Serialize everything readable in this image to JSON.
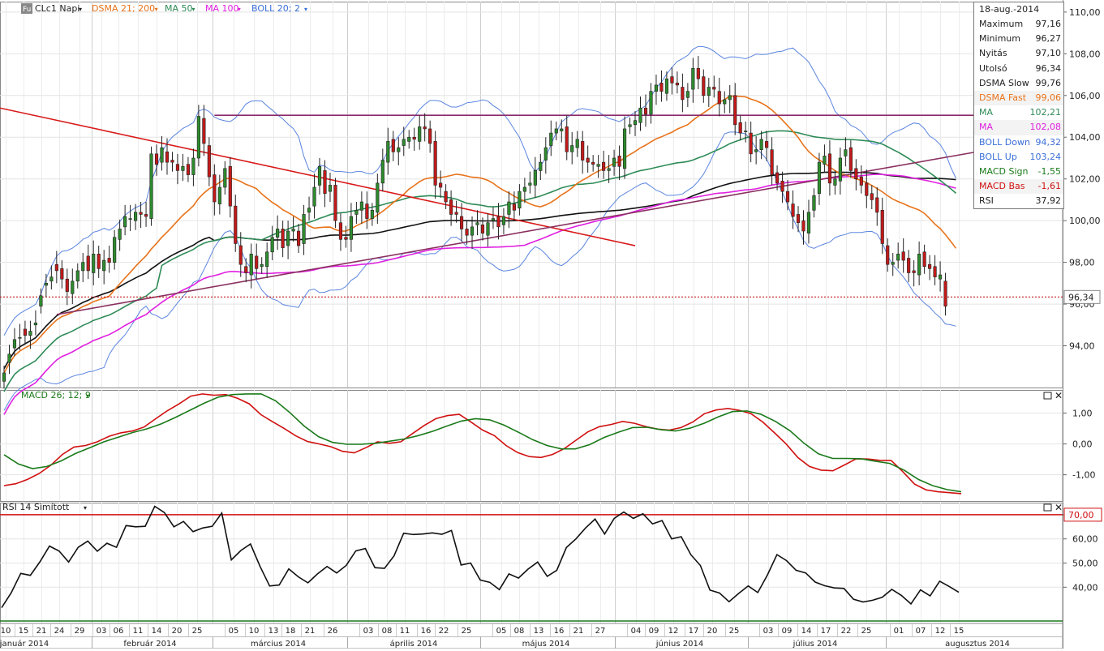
{
  "toolbar": {
    "symbol_badge": "Fu",
    "symbol": "CLc1 Napi",
    "indicators": [
      {
        "label": "DSMA 21; 200",
        "color": "#e8731a"
      },
      {
        "label": "MA 50",
        "color": "#2e8b57"
      },
      {
        "label": "MA 100",
        "color": "#e020e0"
      },
      {
        "label": "BOLL 20; 2",
        "color": "#3a6fd8"
      }
    ]
  },
  "info_box": {
    "date": "18-aug.-2014",
    "rows": [
      {
        "label": "Maximum",
        "value": "97,16",
        "color": "#222222"
      },
      {
        "label": "Minimum",
        "value": "96,27",
        "color": "#222222"
      },
      {
        "label": "Nyitás",
        "value": "97,10",
        "color": "#222222"
      },
      {
        "label": "Utolsó",
        "value": "96,34",
        "color": "#222222"
      },
      {
        "label": "DSMA Slow",
        "value": "99,76",
        "color": "#222222"
      },
      {
        "label": "DSMA Fast",
        "value": "99,06",
        "color": "#e8731a"
      },
      {
        "label": "MA",
        "value": "102,21",
        "color": "#2e8b57"
      },
      {
        "label": "MA",
        "value": "102,08",
        "color": "#e020e0"
      },
      {
        "label": "BOLL Down",
        "value": "94,32",
        "color": "#3a6fd8"
      },
      {
        "label": "BOLL Up",
        "value": "103,24",
        "color": "#3a6fd8"
      },
      {
        "label": "MACD Sign",
        "value": "-1,55",
        "color": "#1a7a1a"
      },
      {
        "label": "MACD Bas",
        "value": "-1,61",
        "color": "#d01010"
      },
      {
        "label": "RSI",
        "value": "37,92",
        "color": "#222222"
      }
    ]
  },
  "macd_panel": {
    "label": "MACD 26; 12; 9"
  },
  "rsi_panel": {
    "label": "RSI 14 Simított",
    "level_label": "70,00"
  },
  "last_price_label": "96,34",
  "colors": {
    "up": "#2e8b2e",
    "down": "#c21a1a",
    "dsma_slow": "#111111",
    "dsma_fast": "#e8731a",
    "ma50": "#2e8b57",
    "ma100": "#e020e0",
    "boll": "#5b85e0",
    "macd_signal": "#1a7a1a",
    "macd_base": "#d01010",
    "rsi": "#111111",
    "trend_red": "#d81a1a",
    "trend_purple": "#8a3060",
    "level_purple": "#8a2a6a",
    "grid": "#cfcfcf"
  },
  "chart_data": [
    {
      "type": "candlestick",
      "title": "",
      "ylim": [
        92,
        110.5
      ],
      "yticks": [
        "94,00",
        "96,00",
        "98,00",
        "100,00",
        "102,00",
        "104,00",
        "106,00",
        "108,00",
        "110,00"
      ],
      "ytick_values": [
        94,
        96,
        98,
        100,
        102,
        104,
        106,
        108,
        110
      ],
      "x_day_labels": [
        "10",
        "15",
        "21",
        "24",
        "29",
        "03",
        "06",
        "11",
        "14",
        "20",
        "25",
        "05",
        "10",
        "13",
        "18",
        "21",
        "26",
        "03",
        "08",
        "11",
        "16",
        "22",
        "25",
        "05",
        "08",
        "13",
        "16",
        "21",
        "27",
        "04",
        "09",
        "12",
        "17",
        "20",
        "25",
        "03",
        "09",
        "14",
        "17",
        "22",
        "25",
        "01",
        "07",
        "12",
        "15"
      ],
      "x_month_labels": [
        "január 2014",
        "február 2014",
        "március 2014",
        "április 2014",
        "május 2014",
        "június 2014",
        "július 2014",
        "augusztus 2014"
      ],
      "close": [
        92.7,
        93.6,
        94.3,
        94.4,
        94.5,
        94.7,
        95.1,
        96.4,
        97.0,
        97.3,
        97.6,
        97.2,
        96.6,
        97.1,
        97.6,
        98.0,
        97.6,
        98.4,
        97.7,
        98.1,
        98.0,
        99.2,
        99.6,
        100.2,
        100.1,
        100.4,
        100.3,
        100.2,
        103.2,
        102.7,
        103.5,
        102.8,
        102.8,
        102.4,
        102.6,
        102.2,
        103.0,
        105.0,
        103.7,
        102.1,
        100.9,
        101.6,
        102.5,
        100.7,
        98.9,
        97.9,
        97.5,
        98.4,
        97.7,
        97.9,
        98.5,
        99.2,
        99.6,
        98.7,
        99.5,
        99.6,
        98.8,
        100.3,
        100.6,
        101.6,
        102.6,
        101.3,
        101.7,
        100.0,
        99.1,
        99.1,
        100.2,
        100.5,
        100.9,
        100.1,
        100.5,
        101.8,
        102.9,
        103.8,
        103.3,
        103.5,
        103.9,
        104.0,
        103.9,
        104.5,
        104.4,
        103.7,
        101.7,
        101.6,
        100.9,
        100.3,
        100.3,
        99.6,
        99.3,
        99.7,
        99.9,
        99.4,
        99.9,
        100.1,
        99.7,
        100.2,
        100.9,
        100.5,
        101.4,
        101.6,
        101.8,
        102.4,
        102.8,
        103.5,
        104.2,
        104.4,
        104.4,
        103.3,
        103.6,
        103.9,
        102.9,
        102.8,
        102.7,
        102.7,
        102.4,
        102.5,
        103.0,
        102.6,
        104.4,
        104.6,
        104.8,
        105.4,
        105.1,
        106.2,
        106.5,
        106.2,
        106.8,
        106.6,
        106.5,
        105.8,
        106.2,
        107.3,
        106.8,
        106.0,
        106.4,
        106.3,
        105.6,
        105.8,
        106.0,
        104.6,
        104.2,
        104.3,
        103.2,
        103.4,
        103.9,
        103.5,
        102.2,
        101.8,
        101.4,
        100.9,
        100.2,
        99.9,
        99.5,
        100.4,
        101.2,
        102.8,
        103.1,
        101.8,
        102.0,
        103.0,
        103.4,
        102.4,
        102.0,
        101.7,
        101.2,
        101.0,
        100.4,
        98.9,
        97.9,
        98.0,
        98.4,
        98.1,
        97.5,
        97.5,
        98.4,
        97.8,
        97.7,
        97.3,
        97.4,
        95.9,
        96.3,
        96.3
      ],
      "open": [
        92.3,
        93.2,
        93.9,
        94.4,
        94.8,
        94.5,
        95.0,
        95.9,
        96.9,
        97.1,
        97.9,
        97.7,
        97.2,
        96.5,
        97.1,
        97.6,
        98.3,
        97.5,
        98.4,
        97.6,
        98.2,
        98.0,
        99.1,
        99.7,
        100.1,
        100.0,
        100.4,
        100.3,
        100.1,
        103.2,
        102.8,
        103.3,
        102.9,
        102.7,
        102.4,
        102.7,
        102.2,
        103.0,
        104.9,
        103.6,
        102.2,
        100.8,
        101.6,
        102.6,
        100.7,
        98.8,
        97.8,
        97.4,
        98.3,
        97.8,
        97.8,
        98.5,
        99.2,
        99.6,
        98.8,
        99.5,
        99.5,
        98.9,
        100.4,
        100.7,
        101.7,
        102.4,
        101.4,
        101.7,
        99.9,
        99.2,
        99.1,
        100.3,
        100.5,
        100.8,
        100.1,
        100.4,
        101.8,
        102.8,
        103.9,
        103.3,
        103.6,
        103.8,
        104.0,
        103.8,
        104.5,
        104.4,
        103.8,
        101.8,
        101.4,
        101.0,
        100.4,
        100.2,
        99.6,
        99.3,
        99.8,
        99.8,
        99.3,
        100.0,
        100.2,
        99.8,
        100.3,
        100.8,
        100.6,
        101.4,
        101.7,
        101.7,
        102.4,
        102.9,
        103.6,
        104.2,
        104.3,
        104.5,
        103.3,
        103.5,
        103.8,
        103.0,
        102.8,
        102.6,
        102.8,
        102.4,
        102.6,
        103.1,
        102.5,
        104.5,
        104.6,
        104.7,
        105.4,
        105.1,
        106.2,
        106.6,
        106.1,
        106.9,
        106.6,
        106.4,
        105.9,
        106.3,
        107.3,
        106.9,
        106.0,
        106.4,
        106.2,
        105.6,
        105.8,
        106.0,
        104.7,
        104.3,
        104.2,
        103.3,
        103.4,
        103.8,
        103.4,
        102.3,
        101.9,
        101.4,
        100.8,
        100.3,
        100.0,
        99.4,
        100.5,
        101.3,
        102.7,
        103.2,
        101.7,
        101.9,
        103.1,
        103.5,
        102.5,
        102.1,
        101.8,
        101.3,
        101.1,
        100.5,
        98.8,
        97.9,
        98.1,
        98.5,
        98.2,
        97.6,
        97.4,
        98.5,
        97.9,
        97.8,
        97.2,
        97.1
      ]
    },
    {
      "type": "line",
      "title": "MACD 26; 12; 9",
      "ylim": [
        -1.85,
        1.75
      ],
      "yticks": [
        "1,00",
        "0,00",
        "-1,00"
      ],
      "ytick_values": [
        1,
        0,
        -1
      ],
      "series": [
        {
          "name": "MACD Bas",
          "values": [
            -1.35,
            -1.29,
            -1.15,
            -0.96,
            -0.69,
            -0.34,
            -0.1,
            -0.05,
            0.07,
            0.25,
            0.36,
            0.42,
            0.55,
            0.82,
            1.08,
            1.3,
            1.55,
            1.62,
            1.58,
            1.6,
            1.48,
            1.3,
            0.95,
            0.72,
            0.5,
            0.26,
            0.08,
            0.0,
            -0.09,
            -0.24,
            -0.29,
            -0.12,
            0.07,
            0.02,
            0.07,
            0.34,
            0.6,
            0.82,
            0.92,
            0.96,
            0.71,
            0.45,
            0.27,
            -0.05,
            -0.28,
            -0.41,
            -0.44,
            -0.34,
            -0.15,
            0.12,
            0.39,
            0.56,
            0.63,
            0.73,
            0.67,
            0.56,
            0.48,
            0.45,
            0.53,
            0.71,
            0.98,
            1.1,
            1.15,
            1.09,
            0.98,
            0.71,
            0.36,
            0.0,
            -0.44,
            -0.73,
            -0.85,
            -0.87,
            -0.68,
            -0.48,
            -0.49,
            -0.53,
            -0.54,
            -0.9,
            -1.3,
            -1.49,
            -1.55,
            -1.58,
            -1.61
          ]
        },
        {
          "name": "MACD Sign",
          "values": [
            -0.35,
            -0.65,
            -0.8,
            -0.73,
            -0.55,
            -0.31,
            -0.12,
            0.07,
            0.22,
            0.37,
            0.49,
            0.65,
            0.86,
            1.09,
            1.32,
            1.52,
            1.6,
            1.62,
            1.62,
            1.4,
            1.02,
            0.58,
            0.24,
            0.05,
            -0.01,
            -0.01,
            0.02,
            0.09,
            0.16,
            0.27,
            0.41,
            0.58,
            0.74,
            0.82,
            0.78,
            0.61,
            0.38,
            0.14,
            -0.05,
            -0.16,
            -0.16,
            -0.02,
            0.21,
            0.38,
            0.53,
            0.54,
            0.46,
            0.42,
            0.51,
            0.67,
            0.88,
            1.05,
            1.07,
            0.96,
            0.73,
            0.43,
            0.02,
            -0.32,
            -0.47,
            -0.47,
            -0.48,
            -0.56,
            -0.63,
            -0.85,
            -1.15,
            -1.35,
            -1.48,
            -1.55
          ]
        }
      ]
    },
    {
      "type": "line",
      "title": "RSI 14 Simított",
      "ylim": [
        25,
        75
      ],
      "yticks": [
        "40,00",
        "50,00",
        "60,00",
        "70,00"
      ],
      "ytick_values": [
        40,
        50,
        60,
        70
      ],
      "series": [
        {
          "name": "RSI",
          "values": [
            31.5,
            37.7,
            45.7,
            44.9,
            50.5,
            57.0,
            55.0,
            50.4,
            56.5,
            59.1,
            54.9,
            58.2,
            56.5,
            65.5,
            65.0,
            65.2,
            73.5,
            70.9,
            65.0,
            67.2,
            63.0,
            64.5,
            65.2,
            70.7,
            51.3,
            55.2,
            57.9,
            48.6,
            40.5,
            40.9,
            47.6,
            44.3,
            41.8,
            45.5,
            48.6,
            45.9,
            49.0,
            55.0,
            56.0,
            48.1,
            47.8,
            53.0,
            62.3,
            61.8,
            62.0,
            62.5,
            61.9,
            63.5,
            49.2,
            50.0,
            43.0,
            42.0,
            39.0,
            45.5,
            43.8,
            47.5,
            50.4,
            44.5,
            47.0,
            56.4,
            60.0,
            64.5,
            68.2,
            62.0,
            68.5,
            71.1,
            68.5,
            70.4,
            66.2,
            67.6,
            60.0,
            60.9,
            53.5,
            49.0,
            38.8,
            37.6,
            34.0,
            37.4,
            40.5,
            37.8,
            45.0,
            53.5,
            51.0,
            47.0,
            45.9,
            42.1,
            40.6,
            39.7,
            39.5,
            35.0,
            33.9,
            34.6,
            35.8,
            39.1,
            36.6,
            33.1,
            38.9,
            36.4,
            42.5,
            40.3,
            37.9
          ]
        }
      ],
      "reference_line": 70
    }
  ]
}
